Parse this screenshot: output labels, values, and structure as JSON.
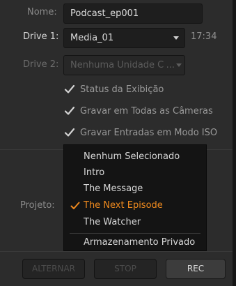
{
  "form": {
    "name_label": "Nome:",
    "name_value": "Podcast_ep001",
    "drive1_label": "Drive 1:",
    "drive1_value": "Media_01",
    "drive1_time": "17:34",
    "drive2_label": "Drive 2:",
    "drive2_value": "Nenhuma Unidade C",
    "drive2_ellipsis": "...",
    "project_label": "Projeto:"
  },
  "checkboxes": [
    {
      "label": "Status da Exibição",
      "checked": true
    },
    {
      "label": "Gravar em Todas as Câmeras",
      "checked": true
    },
    {
      "label": "Gravar Entradas em Modo ISO",
      "checked": true
    }
  ],
  "project_menu": {
    "items": [
      {
        "label": "Nenhum Selecionado",
        "selected": false
      },
      {
        "label": "Intro",
        "selected": false
      },
      {
        "label": "The Message",
        "selected": false
      },
      {
        "label": "The Next Episode",
        "selected": true
      },
      {
        "label": "The Watcher",
        "selected": false
      },
      {
        "label": "Armazenamento Privado",
        "selected": false
      }
    ]
  },
  "buttons": {
    "switch_label": "ALTERNAR",
    "stop_label": "STOP",
    "rec_label": "REC"
  },
  "colors": {
    "selected_accent": "#ef8a1e",
    "panel_bg": "#2c2c2c",
    "menu_bg": "#141414"
  }
}
